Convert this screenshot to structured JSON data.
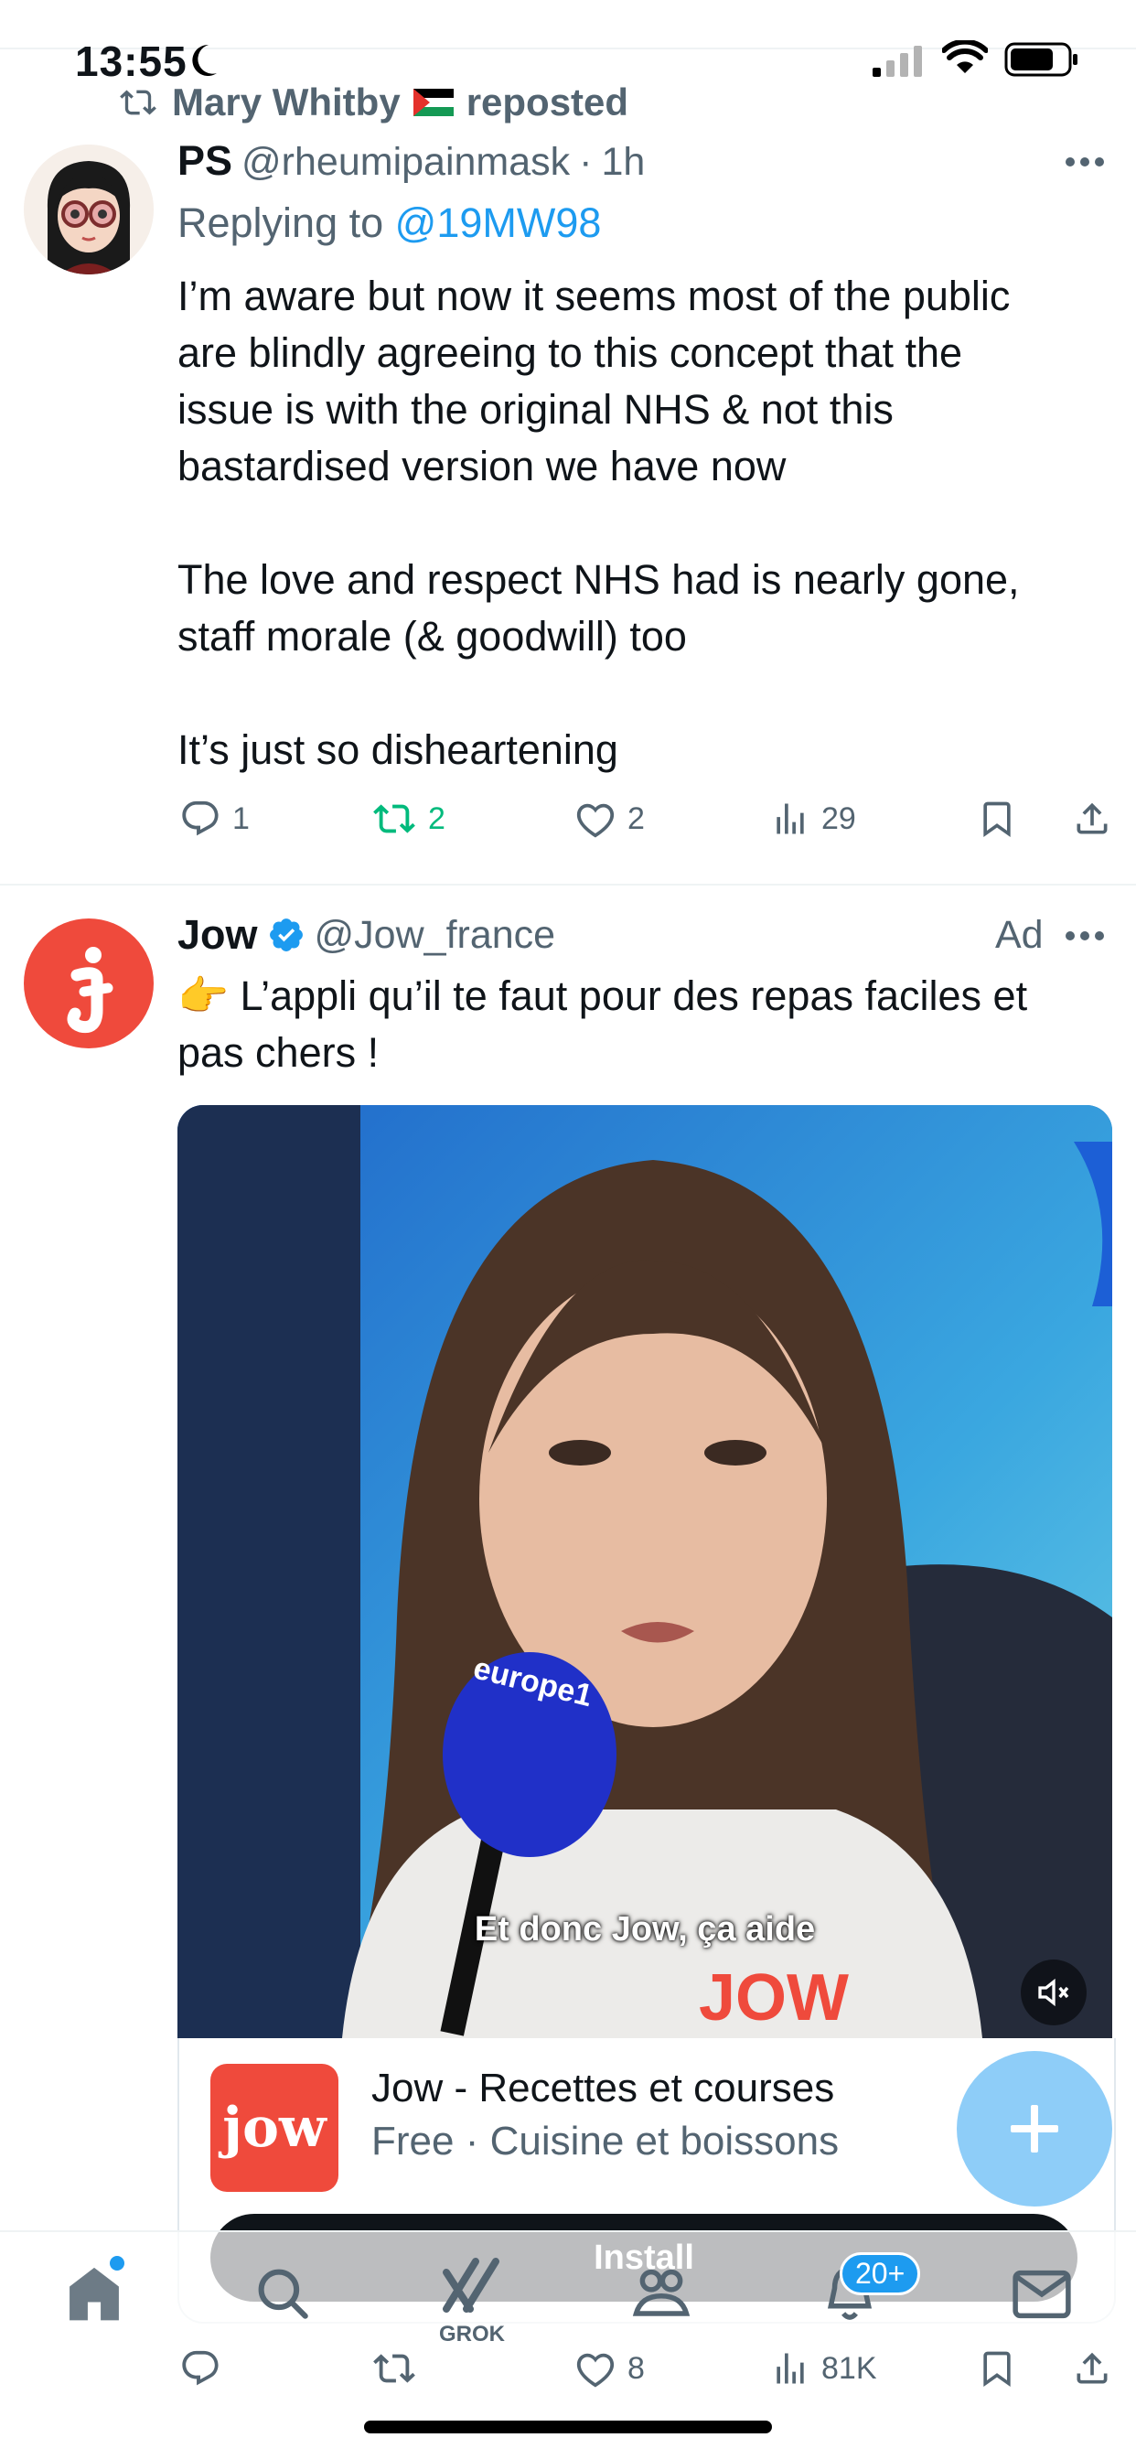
{
  "status_bar": {
    "time": "13:55"
  },
  "tweet1": {
    "reposted_by": "Mary Whitby",
    "reposted_suffix": "reposted",
    "name": "PS",
    "handle": "@rheumipainmask",
    "dot": "·",
    "time": "1h",
    "replying_prefix": "Replying to",
    "replying_to": "@19MW98",
    "text": "I’m aware but now it seems most of the public\nare blindly agreeing to this concept that the\nissue is with the original NHS & not this\nbastardised version we have now\n\nThe love and respect NHS had is nearly gone,\nstaff morale (& goodwill) too\n\nIt’s just so disheartening",
    "replies": "1",
    "reposts": "2",
    "likes": "2",
    "views": "29"
  },
  "ad": {
    "name": "Jow",
    "handle": "@Jow_france",
    "ad_label": "Ad",
    "text": "👉 L’appli qu’il te faut pour des repas faciles et\npas chers !",
    "video_caption": "Et donc Jow, ça aide",
    "mic_brand": "europe1",
    "shirt_text": "JOW",
    "app_icon_text": "jow",
    "app_title": "Jow - Recettes et courses",
    "app_meta": "Free · Cuisine et boissons",
    "install_label": "Install",
    "replies": "",
    "reposts": "",
    "likes": "8",
    "views": "81K"
  },
  "tabbar": {
    "grok_label": "GROK",
    "notifications_badge": "20+"
  },
  "colors": {
    "accent": "#1d9bf0",
    "repost_green": "#00ba7c",
    "jow_red": "#ef4a3c"
  }
}
